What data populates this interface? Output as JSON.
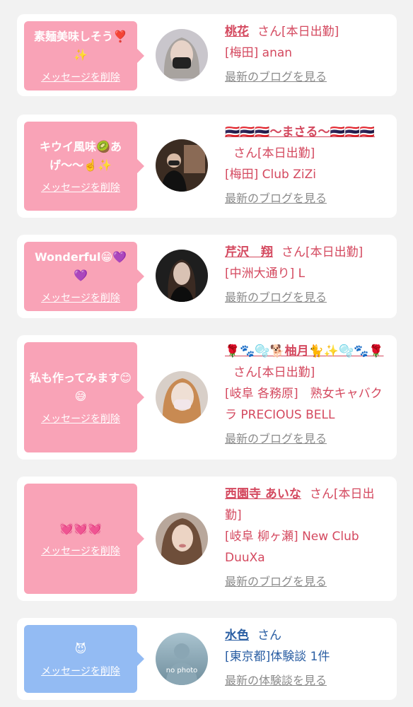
{
  "delete_label": "メッセージを削除",
  "san_label": "さん",
  "cards": [
    {
      "message": "素麺美味しそう❣️✨",
      "name": "桃花",
      "status": "[本日出勤]",
      "shop": "[梅田] anan",
      "link": "最新のブログを見る"
    },
    {
      "message": "キウイ風味🥝あげ〜〜☝️✨",
      "name": "🇹🇭🇹🇭🇹🇭〜まさる〜🇹🇭🇹🇭🇹🇭",
      "status": "[本日出勤]",
      "shop": "[梅田] Club ZiZi",
      "link": "最新のブログを見る"
    },
    {
      "message": "Wonderful😁💜💜",
      "name": "芹沢　翔",
      "status": "[本日出勤]",
      "shop": "[中洲大通り] L",
      "link": "最新のブログを見る"
    },
    {
      "message": "私も作ってみます😊😅",
      "name": "🌹🐾🫧🐕柚月🐈✨🫧🐾🌹",
      "status": "[本日出勤]",
      "shop": "[岐阜 各務原]　熟女キャバクラ PRECIOUS BELL",
      "link": "最新のブログを見る"
    },
    {
      "message": "💓💓💓",
      "name": "西園寺 あいな",
      "status": "[本日出勤]",
      "shop": "[岐阜 柳ヶ瀬] New Club DuuXa",
      "link": "最新のブログを見る"
    },
    {
      "message": "😈",
      "name": "水色",
      "status": "",
      "shop": "[東京都]体験談 1件",
      "link": "最新の体験談を見る",
      "avatar_placeholder": "no photo"
    }
  ],
  "colors": {
    "pink_bubble": "#f9a3b7",
    "blue_bubble": "#93bbf3",
    "pink_text": "#d4495f",
    "blue_text": "#2a5ea3",
    "link_gray": "#8b8b8b"
  }
}
